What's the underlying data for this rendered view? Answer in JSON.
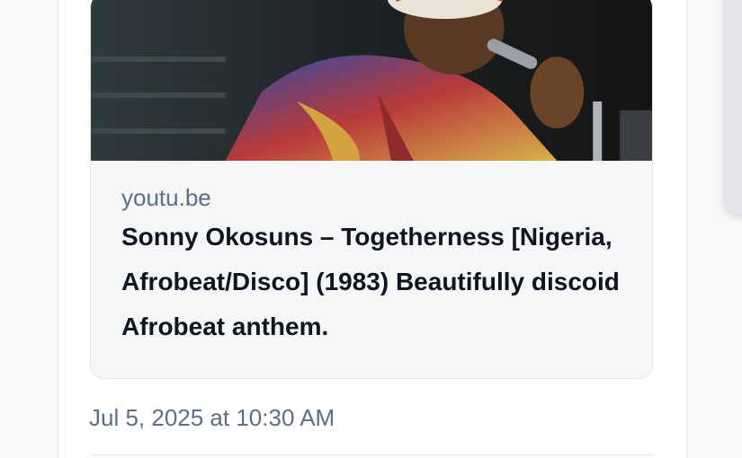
{
  "link_card": {
    "image_icon": "photo-thumbnail",
    "domain": "youtu.be",
    "title": "Sonny Okosuns – Togetherness [Nigeria, Afrobeat/Disco] (1983) Beautifully discoid Afrobeat anthem."
  },
  "post": {
    "timestamp": "Jul 5, 2025 at 10:30 AM"
  },
  "colors": {
    "card_background": "#f5f6f8",
    "muted_text": "#5d6e86",
    "title_text": "#10161f"
  }
}
